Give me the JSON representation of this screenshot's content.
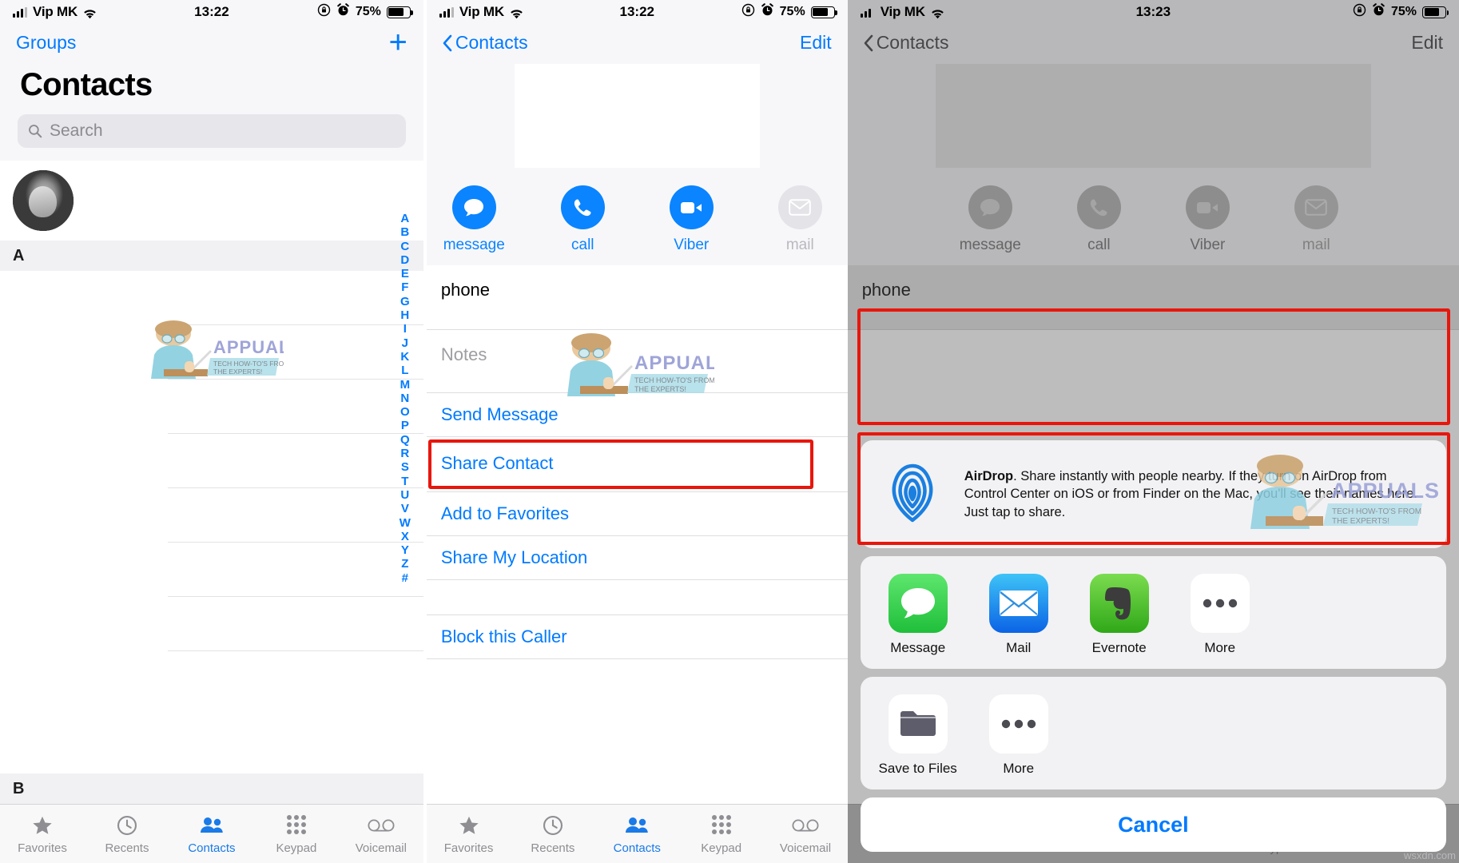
{
  "statusbar": {
    "carrier": "Vip MK",
    "time1": "13:22",
    "time2": "13:22",
    "time3": "13:23",
    "battery": "75%"
  },
  "panel1": {
    "nav": {
      "left": "Groups",
      "add": "+"
    },
    "title": "Contacts",
    "search_placeholder": "Search",
    "section_a": "A",
    "section_b": "B",
    "index_letters": [
      "A",
      "B",
      "C",
      "D",
      "E",
      "F",
      "G",
      "H",
      "I",
      "J",
      "K",
      "L",
      "M",
      "N",
      "O",
      "P",
      "Q",
      "R",
      "S",
      "T",
      "U",
      "V",
      "W",
      "X",
      "Y",
      "Z",
      "#"
    ]
  },
  "panel2": {
    "nav": {
      "back": "Contacts",
      "right": "Edit"
    },
    "actions": [
      {
        "label": "message",
        "icon": "message-bubble-icon",
        "enabled": true
      },
      {
        "label": "call",
        "icon": "phone-handset-icon",
        "enabled": true
      },
      {
        "label": "Viber",
        "icon": "video-camera-icon",
        "enabled": true
      },
      {
        "label": "mail",
        "icon": "envelope-icon",
        "enabled": false
      }
    ],
    "fields": {
      "phone_label": "phone",
      "notes_placeholder": "Notes"
    },
    "items": [
      "Send Message",
      "Share Contact",
      "Add to Favorites",
      "Share My Location",
      "Block this Caller"
    ],
    "highlighted_item": "Share Contact"
  },
  "panel3": {
    "nav": {
      "back": "Contacts",
      "right": "Edit"
    },
    "actions": [
      {
        "label": "message",
        "icon": "message-bubble-icon"
      },
      {
        "label": "call",
        "icon": "phone-handset-icon"
      },
      {
        "label": "Viber",
        "icon": "video-camera-icon"
      },
      {
        "label": "mail",
        "icon": "envelope-icon"
      }
    ],
    "phone_label": "phone",
    "airdrop": {
      "title": "AirDrop",
      "text": ". Share instantly with people nearby. If they turn on AirDrop from Control Center on iOS or from Finder on the Mac, you'll see their names here. Just tap to share.",
      "icon": "airdrop-icon"
    },
    "apps_row": [
      {
        "label": "Message",
        "icon": "messages-app-icon",
        "color": "#4CD964"
      },
      {
        "label": "Mail",
        "icon": "mail-app-icon",
        "color": "#1A7AF8"
      },
      {
        "label": "Evernote",
        "icon": "evernote-app-icon",
        "color": "#5BC63D"
      },
      {
        "label": "More",
        "icon": "ellipsis-icon",
        "color": "#FFFFFF"
      }
    ],
    "actions_row": [
      {
        "label": "Save to Files",
        "icon": "folder-icon",
        "color": "#FFFFFF"
      },
      {
        "label": "More",
        "icon": "ellipsis-icon",
        "color": "#FFFFFF"
      }
    ],
    "cancel": "Cancel"
  },
  "tabbar": {
    "items": [
      {
        "label": "Favorites",
        "icon": "star-icon"
      },
      {
        "label": "Recents",
        "icon": "clock-icon"
      },
      {
        "label": "Contacts",
        "icon": "people-icon"
      },
      {
        "label": "Keypad",
        "icon": "keypad-icon"
      },
      {
        "label": "Voicemail",
        "icon": "voicemail-icon"
      }
    ],
    "active": "Contacts"
  },
  "watermark": {
    "brand": "APPUALS",
    "tagline1": "TECH HOW-TO'S FROM",
    "tagline2": "THE EXPERTS!",
    "corner": "wsxdn.com"
  },
  "colors": {
    "accent": "#007aff",
    "highlight": "#e8160c",
    "tab_active": "#1a7ae8"
  }
}
